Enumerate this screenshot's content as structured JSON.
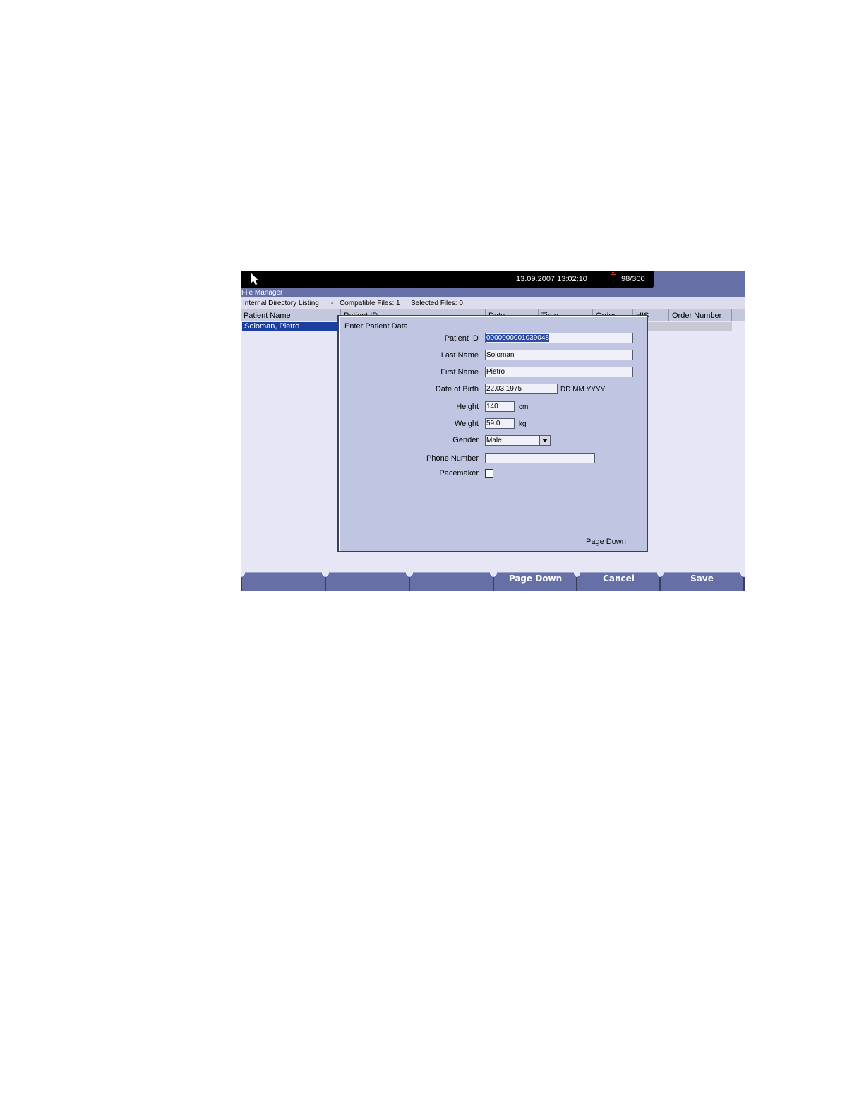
{
  "status_bar": {
    "datetime": "13.09.2007  13:02:10",
    "battery_count": "98/300"
  },
  "window": {
    "title": "File Manager"
  },
  "info_bar": {
    "listing": "Internal Directory Listing",
    "separator": "-",
    "compatible_files": "Compatible Files: 1",
    "selected_files": "Selected Files: 0"
  },
  "table": {
    "headers": [
      "Patient Name",
      "Patient ID",
      "Date",
      "Time",
      "Order",
      "HIS",
      "Order Number"
    ],
    "rows": [
      {
        "patient_name": "Soloman, Pietro"
      }
    ]
  },
  "dialog": {
    "title": "Enter Patient Data",
    "fields": {
      "patient_id": {
        "label": "Patient ID",
        "value": "0000000001039048"
      },
      "last_name": {
        "label": "Last Name",
        "value": "Soloman"
      },
      "first_name": {
        "label": "First Name",
        "value": "Pietro"
      },
      "dob": {
        "label": "Date of Birth",
        "value": "22.03.1975",
        "format": "DD.MM.YYYY"
      },
      "height": {
        "label": "Height",
        "value": "140",
        "unit": "cm"
      },
      "weight": {
        "label": "Weight",
        "value": "59.0",
        "unit": "kg"
      },
      "gender": {
        "label": "Gender",
        "value": "Male"
      },
      "phone": {
        "label": "Phone Number",
        "value": ""
      },
      "pacemaker": {
        "label": "Pacemaker",
        "checked": false
      }
    },
    "page_down": "Page Down"
  },
  "softkeys": [
    "",
    "",
    "",
    "Page Down",
    "Cancel",
    "Save"
  ]
}
